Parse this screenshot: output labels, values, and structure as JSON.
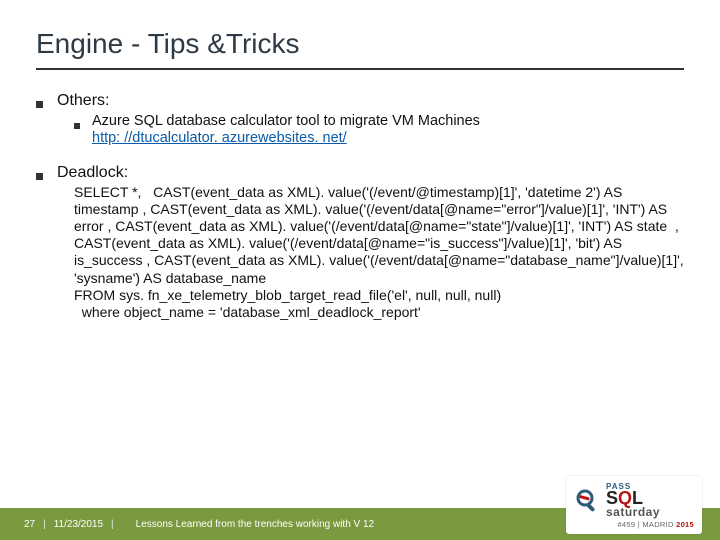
{
  "title": "Engine - Tips &Tricks",
  "sections": {
    "others": {
      "heading": "Others:",
      "item": "Azure SQL database calculator tool to migrate VM Machines",
      "link": "http: //dtucalculator. azurewebsites. net/"
    },
    "deadlock": {
      "heading": "Deadlock:",
      "code": "SELECT *,   CAST(event_data as XML). value('(/event/@timestamp)[1]', 'datetime 2') AS timestamp , CAST(event_data as XML). value('(/event/data[@name=\"error\"]/value)[1]', 'INT') AS error , CAST(event_data as XML). value('(/event/data[@name=\"state\"]/value)[1]', 'INT') AS state  , CAST(event_data as XML). value('(/event/data[@name=\"is_success\"]/value)[1]', 'bit') AS is_success , CAST(event_data as XML). value('(/event/data[@name=\"database_name\"]/value)[1]', 'sysname') AS database_name\nFROM sys. fn_xe_telemetry_blob_target_read_file('el', null, null, null)\n  where object_name = 'database_xml_deadlock_report'"
    }
  },
  "footer": {
    "page": "27",
    "date": "11/23/2015",
    "title": "Lessons Learned from the trenches working with V 12"
  },
  "logo": {
    "pass": "PASS",
    "sql_s": "S",
    "sql_q": "Q",
    "sql_l": "L",
    "saturday": "saturday",
    "event": "#459 | MADRID ",
    "year": "2015"
  }
}
